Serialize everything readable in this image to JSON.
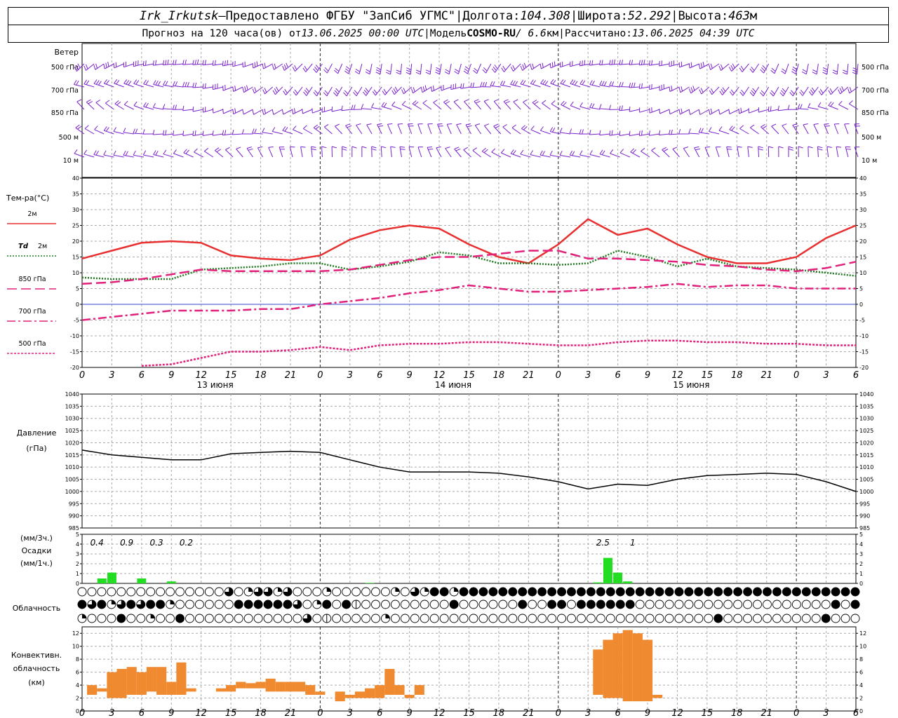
{
  "header": {
    "station": "Irk_Irkutsk",
    "dash": " — ",
    "provider": "Предоставлено ФГБУ \"ЗапСиб УГМС\"",
    "sep": " | ",
    "lon_label": "Долгота: ",
    "lon_value": "104.308",
    "lat_label": "Широта: ",
    "lat_value": "52.292",
    "alt_label": "Высота: ",
    "alt_value": "463",
    "alt_unit": "м",
    "forecast_label": "Прогноз на 120 часа(ов) от ",
    "forecast_start": "13.06.2025 00:00 UTC",
    "model_label": "Модель ",
    "model_name": "COSMO-RU",
    "model_res": " / 6.6",
    "model_res_unit": "км",
    "computed_label": "Рассчитано: ",
    "computed_time": "13.06.2025 04:39 UTC"
  },
  "chart_data": [
    {
      "type": "wind-barbs",
      "title": "Ветер",
      "levels": [
        "500 гПа",
        "700 гПа",
        "850 гПа",
        "500 м",
        "10 м"
      ],
      "barb_color": "#7a22cc",
      "step_hours": 1,
      "x_range_hours": [
        0,
        78
      ]
    },
    {
      "type": "line",
      "title": "Тем-ра(°С)",
      "ylim": [
        -20,
        40
      ],
      "yticks": [
        -20,
        -15,
        -10,
        -5,
        0,
        5,
        10,
        15,
        20,
        25,
        30,
        35,
        40
      ],
      "xlabel_ticks": [
        "0",
        "3",
        "6",
        "9",
        "12",
        "15",
        "18",
        "21",
        "0",
        "3",
        "6",
        "9",
        "12",
        "15",
        "18",
        "21",
        "0",
        "3",
        "6",
        "9",
        "12",
        "15",
        "18",
        "21",
        "0",
        "3",
        "6"
      ],
      "day_labels": [
        "13 июня",
        "14 июня",
        "15 июня"
      ],
      "x": [
        0,
        3,
        6,
        9,
        12,
        15,
        18,
        21,
        24,
        27,
        30,
        33,
        36,
        39,
        42,
        45,
        48,
        51,
        54,
        57,
        60,
        63,
        66,
        69,
        72,
        75,
        78
      ],
      "series": [
        {
          "name": "2м",
          "color": "#e83030",
          "dash": "solid",
          "values": [
            14.5,
            17,
            19.5,
            20,
            19.5,
            15.5,
            14.5,
            14,
            15.5,
            20.5,
            23.5,
            25,
            24,
            19,
            15,
            13,
            19,
            27,
            22,
            24,
            19,
            15,
            13,
            13,
            15,
            21,
            25
          ]
        },
        {
          "name": "2м",
          "prefix": "Td",
          "color": "#1f7a1f",
          "dash": "dot",
          "values": [
            8.5,
            8,
            8,
            8,
            11,
            11.5,
            12,
            13,
            13,
            11,
            12,
            13.5,
            16.5,
            15.5,
            13,
            13,
            12.5,
            13,
            17,
            15,
            12,
            14.5,
            12,
            11.5,
            11,
            10,
            9
          ]
        },
        {
          "name": "850 гПа",
          "color": "#e0207a",
          "dash": "longdash",
          "values": [
            6.5,
            7,
            8,
            9.5,
            11,
            10.5,
            10.5,
            10.5,
            10.5,
            11,
            12.5,
            14,
            15,
            15,
            16,
            17,
            17,
            14.5,
            14.5,
            14,
            13.5,
            12.5,
            12,
            11,
            10.5,
            11.5,
            13.5
          ]
        },
        {
          "name": "700 гПа",
          "color": "#e0207a",
          "dash": "dashdot",
          "values": [
            -5,
            -4,
            -3,
            -2,
            -2,
            -2,
            -1.5,
            -1.5,
            0,
            1,
            2,
            3.5,
            4.5,
            6,
            5,
            4,
            4,
            4.5,
            5,
            5.5,
            6.5,
            5.5,
            6,
            6,
            5,
            5,
            5
          ]
        },
        {
          "name": "500 гПа",
          "color": "#e0207a",
          "dash": "fine",
          "values": [
            null,
            null,
            -19.5,
            -19,
            -17,
            -15,
            -15,
            -14.5,
            -13.5,
            -14.5,
            -13,
            -12.5,
            -12.5,
            -12,
            -12,
            -12.5,
            -13,
            -13,
            -12,
            -11.5,
            -11.5,
            -12,
            -12,
            -12.5,
            -12.5,
            -13,
            -13
          ]
        }
      ]
    },
    {
      "type": "line",
      "title": "Давление",
      "ylabel": "(гПа)",
      "ylim": [
        985,
        1040
      ],
      "yticks": [
        985,
        990,
        995,
        1000,
        1005,
        1010,
        1015,
        1020,
        1025,
        1030,
        1035,
        1040
      ],
      "x": [
        0,
        3,
        6,
        9,
        12,
        15,
        18,
        21,
        24,
        27,
        30,
        33,
        36,
        39,
        42,
        45,
        48,
        51,
        54,
        57,
        60,
        63,
        66,
        69,
        72,
        75,
        78
      ],
      "series": [
        {
          "name": "pressure",
          "color": "#000000",
          "values": [
            1017,
            1015,
            1014,
            1013,
            1013,
            1015.5,
            1016,
            1016.5,
            1016,
            1013,
            1010,
            1008,
            1008,
            1008,
            1007.5,
            1006,
            1004,
            1001,
            1003,
            1002.5,
            1005,
            1006.5,
            1007,
            1007.5,
            1007,
            1004,
            1000
          ]
        }
      ]
    },
    {
      "type": "bar",
      "title": "Осадки",
      "ylabel_top": "(мм/3ч.)",
      "ylabel_bottom": "(мм/1ч.)",
      "ylim": [
        0,
        5
      ],
      "yticks": [
        0,
        1,
        2,
        3,
        4,
        5
      ],
      "color": "#22dd22",
      "hours": [
        2,
        3,
        6,
        9,
        29,
        52,
        53,
        54,
        55
      ],
      "values": [
        0.5,
        1.1,
        0.5,
        0.2,
        0.05,
        0.1,
        2.6,
        1.1,
        0.2
      ],
      "annotations": [
        {
          "hour": 1.5,
          "text": "0.4"
        },
        {
          "hour": 4.5,
          "text": "0.9"
        },
        {
          "hour": 7.5,
          "text": "0.3"
        },
        {
          "hour": 10.5,
          "text": "0.2"
        },
        {
          "hour": 52.5,
          "text": "2.5"
        },
        {
          "hour": 55.5,
          "text": "1"
        }
      ]
    },
    {
      "type": "table",
      "title": "Облачность",
      "rows": [
        "000000000000000302332300020000002032442444444444444444444444444444444444444444444",
        "4342343442000000444444302404100000000040000004004404444440000000000000000000040443",
        "20004002004000000000000301000002000000000000000000000000000000000400000000004000000"
      ]
    },
    {
      "type": "bar",
      "title": "Конвективн. облачность",
      "ylabel": "(км)",
      "ylim": [
        0,
        13
      ],
      "yticks": [
        0,
        2,
        4,
        6,
        8,
        10,
        12
      ],
      "color": "#f08a30",
      "bars": [
        {
          "h0": 0.5,
          "h1": 1.5,
          "base": 2.5,
          "top": 4.0
        },
        {
          "h0": 1.5,
          "h1": 2.5,
          "base": 3.0,
          "top": 3.5
        },
        {
          "h0": 2.5,
          "h1": 3.5,
          "base": 2.0,
          "top": 6.0
        },
        {
          "h0": 3.5,
          "h1": 4.5,
          "base": 2.0,
          "top": 6.5
        },
        {
          "h0": 4.5,
          "h1": 5.5,
          "base": 2.5,
          "top": 6.8
        },
        {
          "h0": 5.5,
          "h1": 6.5,
          "base": 2.5,
          "top": 6.0
        },
        {
          "h0": 6.5,
          "h1": 7.5,
          "base": 3.0,
          "top": 6.8
        },
        {
          "h0": 7.5,
          "h1": 8.5,
          "base": 2.5,
          "top": 6.8
        },
        {
          "h0": 8.5,
          "h1": 9.5,
          "base": 2.5,
          "top": 4.5
        },
        {
          "h0": 9.5,
          "h1": 10.5,
          "base": 2.5,
          "top": 7.5
        },
        {
          "h0": 10.5,
          "h1": 11.5,
          "base": 3.0,
          "top": 3.5
        },
        {
          "h0": 13.5,
          "h1": 14.5,
          "base": 3.0,
          "top": 3.5
        },
        {
          "h0": 14.5,
          "h1": 15.5,
          "base": 3.0,
          "top": 4.0
        },
        {
          "h0": 15.5,
          "h1": 16.5,
          "base": 3.5,
          "top": 4.5
        },
        {
          "h0": 16.5,
          "h1": 17.5,
          "base": 3.5,
          "top": 4.3
        },
        {
          "h0": 17.5,
          "h1": 18.5,
          "base": 3.5,
          "top": 4.5
        },
        {
          "h0": 18.5,
          "h1": 19.5,
          "base": 3.0,
          "top": 5.0
        },
        {
          "h0": 19.5,
          "h1": 20.5,
          "base": 3.0,
          "top": 4.5
        },
        {
          "h0": 20.5,
          "h1": 21.5,
          "base": 3.0,
          "top": 4.5
        },
        {
          "h0": 21.5,
          "h1": 22.5,
          "base": 3.0,
          "top": 4.5
        },
        {
          "h0": 22.5,
          "h1": 23.5,
          "base": 2.5,
          "top": 4.0
        },
        {
          "h0": 23.5,
          "h1": 24.5,
          "base": 2.5,
          "top": 3.0
        },
        {
          "h0": 25.5,
          "h1": 26.5,
          "base": 1.5,
          "top": 3.0
        },
        {
          "h0": 26.5,
          "h1": 27.5,
          "base": 2.0,
          "top": 2.5
        },
        {
          "h0": 27.5,
          "h1": 28.5,
          "base": 2.0,
          "top": 3.0
        },
        {
          "h0": 28.5,
          "h1": 29.5,
          "base": 2.0,
          "top": 3.5
        },
        {
          "h0": 29.5,
          "h1": 30.5,
          "base": 2.0,
          "top": 4.0
        },
        {
          "h0": 30.5,
          "h1": 31.5,
          "base": 2.5,
          "top": 6.5
        },
        {
          "h0": 31.5,
          "h1": 32.5,
          "base": 2.5,
          "top": 4.0
        },
        {
          "h0": 32.5,
          "h1": 33.5,
          "base": 2.0,
          "top": 2.5
        },
        {
          "h0": 33.5,
          "h1": 34.5,
          "base": 2.5,
          "top": 4.0
        },
        {
          "h0": 51.5,
          "h1": 52.5,
          "base": 2.5,
          "top": 9.5
        },
        {
          "h0": 52.5,
          "h1": 53.5,
          "base": 2.0,
          "top": 11.0
        },
        {
          "h0": 53.5,
          "h1": 54.5,
          "base": 2.0,
          "top": 12.0
        },
        {
          "h0": 54.5,
          "h1": 55.5,
          "base": 1.5,
          "top": 12.5
        },
        {
          "h0": 55.5,
          "h1": 56.5,
          "base": 1.5,
          "top": 12.0
        },
        {
          "h0": 56.5,
          "h1": 57.5,
          "base": 1.5,
          "top": 11.0
        },
        {
          "h0": 57.5,
          "h1": 58.5,
          "base": 2.0,
          "top": 2.5
        }
      ]
    }
  ]
}
